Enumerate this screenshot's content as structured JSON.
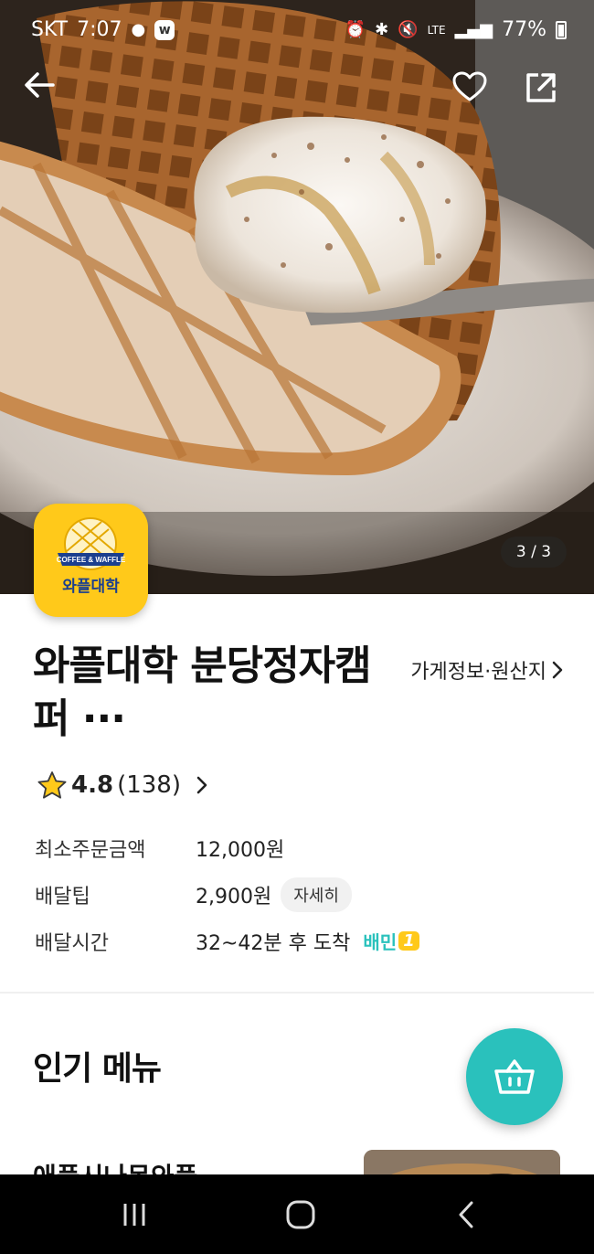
{
  "status_bar": {
    "carrier": "SKT",
    "time": "7:07",
    "battery": "77%",
    "network": "LTE"
  },
  "hero": {
    "page_indicator": "3 / 3"
  },
  "logo": {
    "text": "와플대학",
    "ribbon_text": "COFFEE & WAFFLE"
  },
  "store": {
    "name": "와플대학 분당정자캠퍼 ···",
    "info_link": "가게정보·원산지",
    "rating": "4.8",
    "review_count": "(138)"
  },
  "details": {
    "min_order_label": "최소주문금액",
    "min_order_value": "12,000원",
    "delivery_tip_label": "배달팁",
    "delivery_tip_value": "2,900원",
    "detail_chip": "자세히",
    "delivery_time_label": "배달시간",
    "delivery_time_value": "32~42분 후 도착",
    "baemin_one": "배민",
    "baemin_one_number": "1"
  },
  "popular": {
    "title": "인기 메뉴",
    "first_item": "애플시나몬와플"
  },
  "colors": {
    "accent": "#2ac1bc",
    "logo_bg": "#ffc91a",
    "brand_blue": "#1b3f8f"
  }
}
